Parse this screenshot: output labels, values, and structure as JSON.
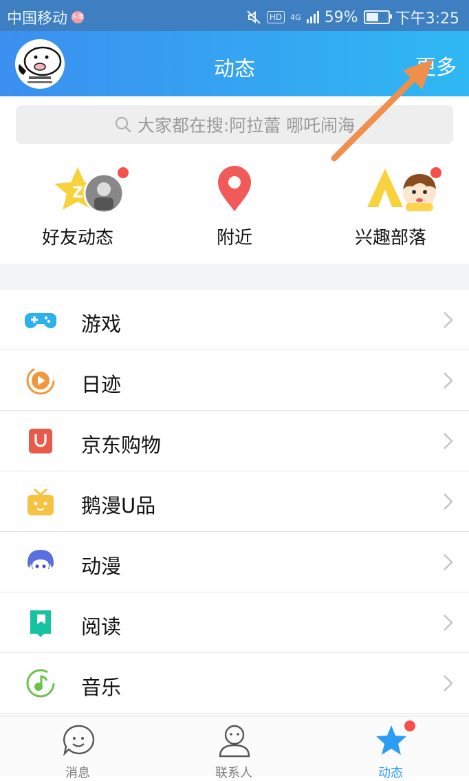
{
  "status_bar": {
    "carrier": "中国移动",
    "badge_text": "头像",
    "network": "4G",
    "hd": "HD",
    "battery_percent": "59%",
    "battery_level": 0.59,
    "time": "下午3:25"
  },
  "header": {
    "title": "动态",
    "more_label": "更多",
    "avatar_icon": "cartoon-avatar-icon"
  },
  "search": {
    "placeholder": "大家都在搜:阿拉蕾 哪吒闹海"
  },
  "quick": {
    "items": [
      {
        "label": "好友动态",
        "icon": "friends-feed-icon"
      },
      {
        "label": "附近",
        "icon": "location-pin-icon"
      },
      {
        "label": "兴趣部落",
        "icon": "tribe-tent-icon"
      }
    ]
  },
  "list": {
    "items": [
      {
        "label": "游戏",
        "icon": "gamepad-icon",
        "color": "#2db0f0"
      },
      {
        "label": "日迹",
        "icon": "play-circle-icon",
        "color": "#f2963a"
      },
      {
        "label": "京东购物",
        "icon": "shopping-bag-icon",
        "color": "#e85a4a"
      },
      {
        "label": "鹅漫U品",
        "icon": "gift-box-icon",
        "color": "#f6c244"
      },
      {
        "label": "动漫",
        "icon": "anime-face-icon",
        "color": "#5a6fe0"
      },
      {
        "label": "阅读",
        "icon": "book-icon",
        "color": "#16c3a0"
      },
      {
        "label": "音乐",
        "icon": "music-note-icon",
        "color": "#6cc24a"
      }
    ]
  },
  "bottom_nav": {
    "tabs": [
      {
        "label": "消息",
        "icon": "message-bubble-icon"
      },
      {
        "label": "联系人",
        "icon": "contacts-icon"
      },
      {
        "label": "动态",
        "icon": "star-icon"
      }
    ],
    "active": "动态"
  },
  "colors": {
    "status_bar": "#3d7fc0",
    "header_start": "#3b8ff0",
    "header_end": "#2fb8f3",
    "accent": "#2d9df3",
    "badge_red": "#f5514a"
  }
}
